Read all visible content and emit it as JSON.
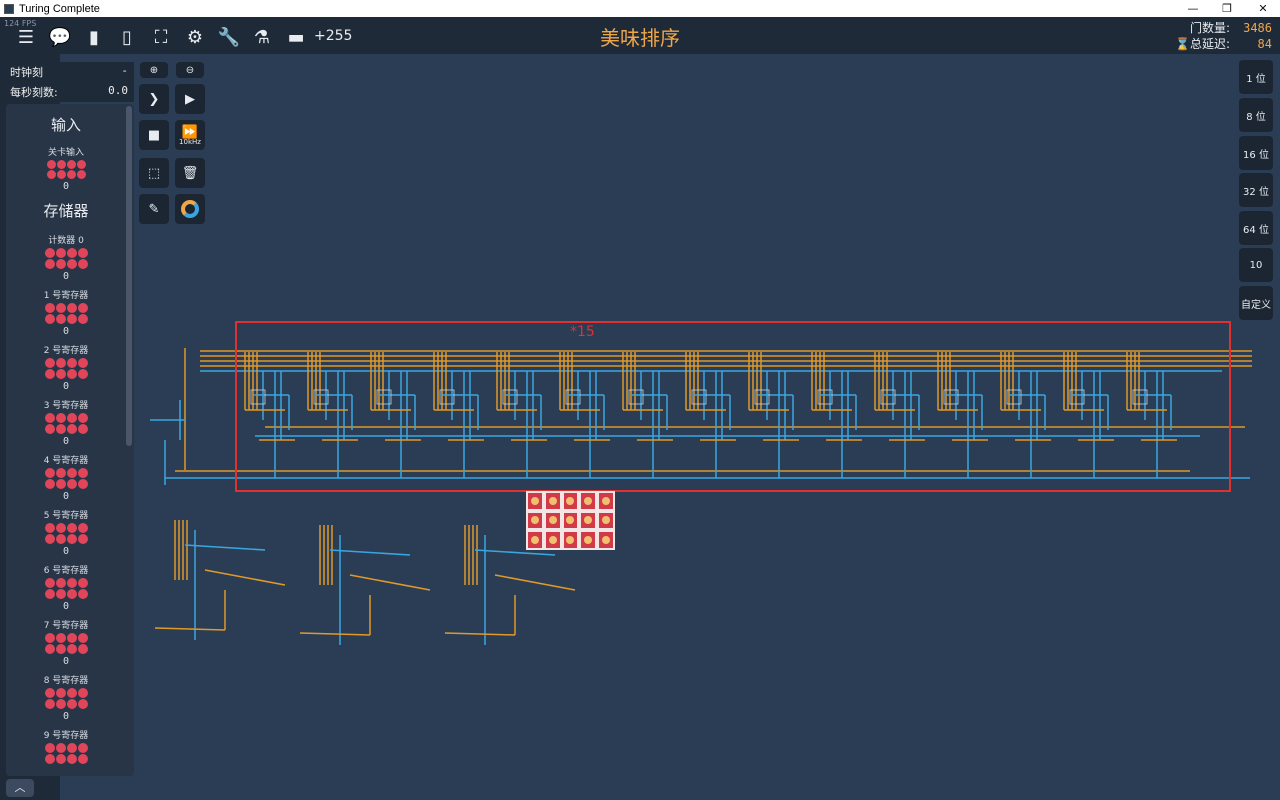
{
  "window": {
    "title": "Turing Complete",
    "fps": "124 FPS"
  },
  "toolbar": {
    "icons": [
      "menu-icon",
      "chat-icon",
      "document-icon",
      "book-icon",
      "hierarchy-icon",
      "gear-icon",
      "wrench-icon",
      "flask-icon",
      "hat-icon"
    ],
    "score_delta": "+255",
    "level_title": "美味排序"
  },
  "stats": {
    "gates_label": "门数量:",
    "gates_value": "3486",
    "delay_label": "⌛总延迟:",
    "delay_value": "84"
  },
  "clock": {
    "tick_label": "时钟刻",
    "tick_value": "-",
    "tps_label": "每秒刻数:",
    "tps_value": "0.0"
  },
  "controls": {
    "fast_label": "10kHz"
  },
  "sidebar": {
    "inputs_heading": "输入",
    "level_input_label": "关卡输入",
    "level_input_value": "0",
    "storage_heading": "存储器",
    "counter_label": "计数器 0",
    "counter_value": "0",
    "registers": [
      {
        "label": "1 号寄存器",
        "value": "0"
      },
      {
        "label": "2 号寄存器",
        "value": "0"
      },
      {
        "label": "3 号寄存器",
        "value": "0"
      },
      {
        "label": "4 号寄存器",
        "value": "0"
      },
      {
        "label": "5 号寄存器",
        "value": "0"
      },
      {
        "label": "6 号寄存器",
        "value": "0"
      },
      {
        "label": "7 号寄存器",
        "value": "0"
      },
      {
        "label": "8 号寄存器",
        "value": "0"
      },
      {
        "label": "9 号寄存器",
        "value": ""
      }
    ]
  },
  "bit_buttons": [
    "1 位",
    "8 位",
    "16 位",
    "32 位",
    "64 位",
    "10",
    "自定义"
  ],
  "annotation": "*15",
  "colors": {
    "accent": "#f0a64a",
    "wire_blue": "#3aa6e0",
    "wire_orange": "#e09a2a",
    "highlight": "#e03030",
    "background": "#2b3d55"
  }
}
